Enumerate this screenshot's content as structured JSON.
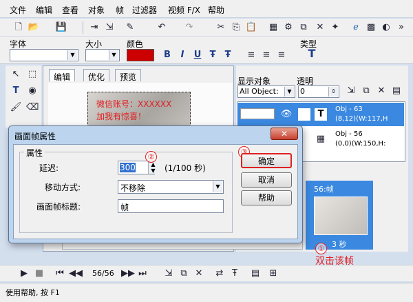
{
  "menu": [
    "文件",
    "编辑",
    "查看",
    "对象",
    "帧",
    "过滤器",
    "视频 F/X",
    "帮助"
  ],
  "props": {
    "font_label": "字体",
    "size_label": "大小",
    "color_label": "颜色",
    "type_label": "类型",
    "color_value": "#cc0000"
  },
  "tabs": [
    "编辑",
    "优化",
    "预览"
  ],
  "canvas_text": [
    "微信账号：XXXXXX",
    "加我有惊喜！"
  ],
  "right_panel": {
    "show_objects_label": "显示对象",
    "opacity_label": "透明",
    "filter_value": "All Object:",
    "opacity_value": "0",
    "objects": [
      {
        "name": "Obj - 63",
        "info": "(8,12)(W:117,H"
      },
      {
        "name": "Obj - 56",
        "info": "(0,0)(W:150,H:"
      }
    ]
  },
  "frame": {
    "label": "56:帧",
    "duration": "3 秒"
  },
  "callout": "双击该帧",
  "playbar": {
    "position": "56/56"
  },
  "status": "使用帮助, 按 F1",
  "dialog": {
    "title": "画面帧属性",
    "close": "✕",
    "group_label": "属性",
    "delay_label": "延迟:",
    "delay_value": "300",
    "delay_unit": "(1/100 秒)",
    "move_label": "移动方式:",
    "move_value": "不移除",
    "title_label": "画面帧标题:",
    "title_value": "帧",
    "ok": "确定",
    "cancel": "取消",
    "help": "帮助"
  },
  "markers": [
    "①",
    "②",
    "③"
  ]
}
